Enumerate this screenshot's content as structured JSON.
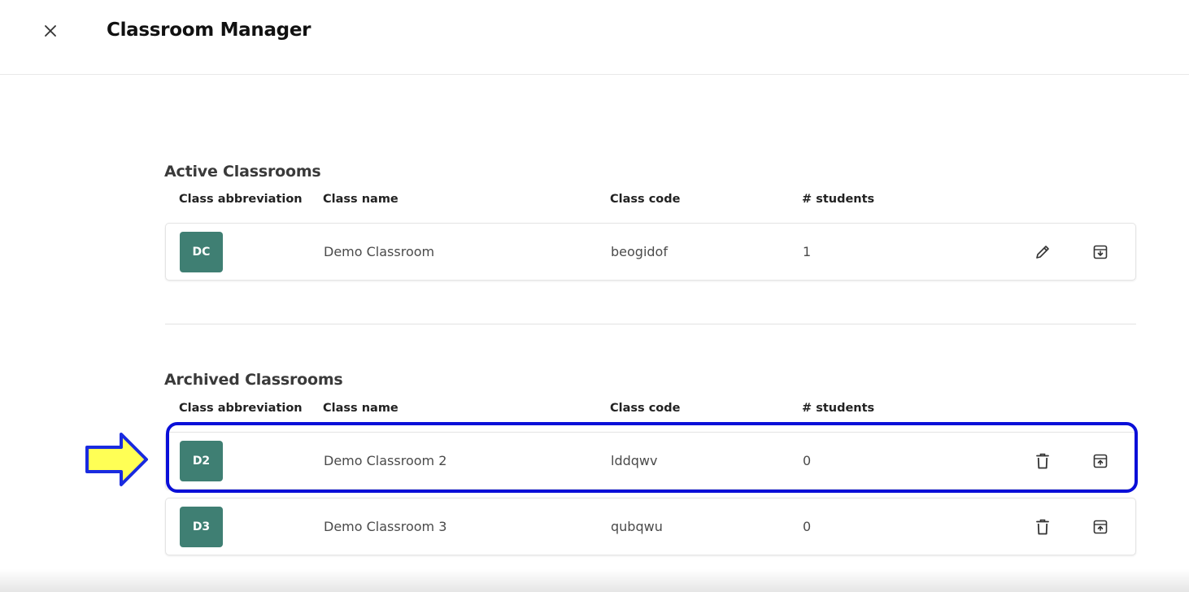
{
  "header": {
    "title": "Classroom Manager"
  },
  "columns": {
    "abbreviation": "Class abbreviation",
    "name": "Class name",
    "code": "Class code",
    "students": "# students"
  },
  "active": {
    "title": "Active Classrooms",
    "rows": [
      {
        "abbr": "DC",
        "name": "Demo Classroom",
        "code": "beogidof",
        "students": "1"
      }
    ]
  },
  "archived": {
    "title": "Archived Classrooms",
    "rows": [
      {
        "abbr": "D2",
        "name": "Demo Classroom 2",
        "code": "lddqwv",
        "students": "0"
      },
      {
        "abbr": "D3",
        "name": "Demo Classroom 3",
        "code": "qubqwu",
        "students": "0"
      }
    ]
  },
  "colors": {
    "abbr_badge": "#3f7f73",
    "highlight_border": "#0a0fd8",
    "arrow_fill": "#ffff55",
    "arrow_stroke": "#1a2be0"
  },
  "icons": {
    "close": "close-icon",
    "edit": "pencil-icon",
    "archive": "archive-icon",
    "delete": "trash-icon",
    "unarchive": "unarchive-icon"
  }
}
